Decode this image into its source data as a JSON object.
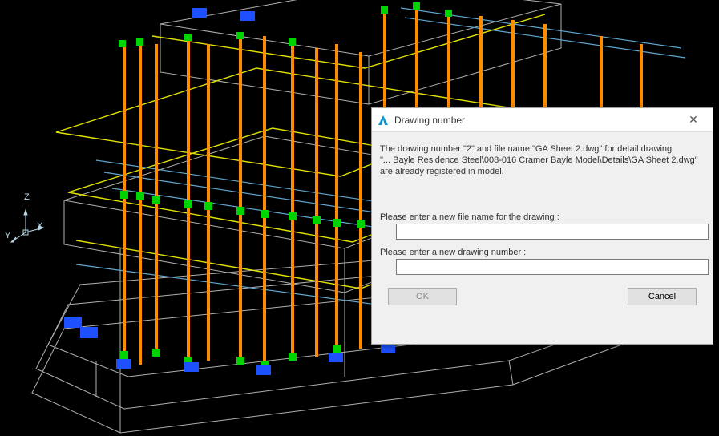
{
  "coord_axes": {
    "z": "Z",
    "y": "Y",
    "x": "X"
  },
  "dialog": {
    "title": "Drawing number",
    "message": "The drawing number \"2\" and file name \"GA Sheet 2.dwg\" for detail drawing\n\"... Bayle Residence Steel\\008-016 Cramer  Bayle Model\\Details\\GA Sheet 2.dwg\"\n are already registered in model.",
    "filename_label": "Please enter a new file name for the drawing :",
    "filename_value": "",
    "number_label": "Please enter a new drawing number :",
    "number_value": "",
    "ok_label": "OK",
    "cancel_label": "Cancel",
    "close_symbol": "✕"
  },
  "colors": {
    "steel_column": "#ff8c00",
    "steel_connector": "#00d400",
    "steel_detail": "#1e50ff",
    "slab_edge": "#e2e200",
    "frame_wire": "#b0b0b0",
    "floor_line": "#5fa8d3"
  }
}
